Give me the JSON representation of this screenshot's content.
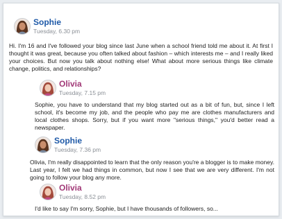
{
  "messages": [
    {
      "author": "Sophie",
      "time": "Tuesday, 6.30 pm",
      "text": "Hi. I'm 16 and I've followed your blog since last June when a school friend told me about it. At first I thought it was great, because you often talked about fashion – which interests me – and I really liked your choices. But now you talk about nothing else! What about more serious things like climate change, politics, and relationships?"
    },
    {
      "author": "Olivia",
      "time": "Tuesday, 7.15 pm",
      "text": "Sophie, you have to understand that my blog started out as a bit of fun, but, since I left school, it's become my job, and the people who pay me are clothes manufacturers and local clothes shops. Sorry, but if you want more \"serious things,\" you'd better read a newspaper."
    },
    {
      "author": "Sophie",
      "time": "Tuesday, 7.36 pm",
      "text": "Olivia, I'm really disappointed to learn that the only reason you're a blogger is to make money. Last year, I felt we had things in common, but now I see that we are very different. I'm not going to follow your blog any more."
    },
    {
      "author": "Olivia",
      "time": "Tuesday, 8.52 pm",
      "text": "I'd like to say I'm sorry, Sophie, but I have thousands of followers, so..."
    }
  ]
}
